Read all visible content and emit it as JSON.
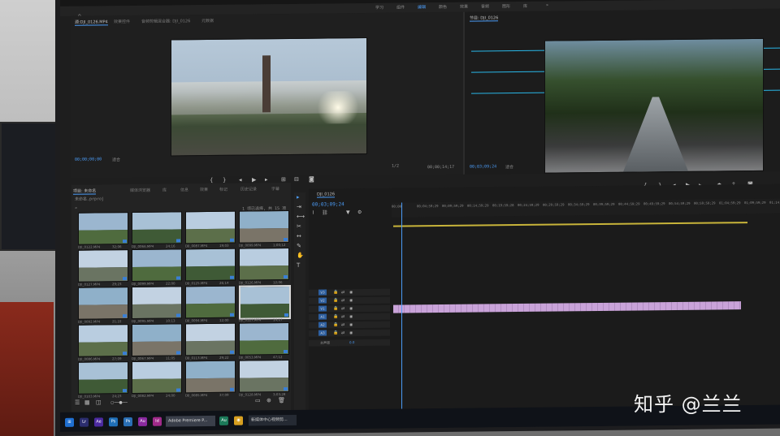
{
  "workspaces": [
    "学习",
    "组件",
    "编辑",
    "颜色",
    "效果",
    "音频",
    "图形",
    "库"
  ],
  "active_workspace": "编辑",
  "source": {
    "tabs": [
      "源:DJI_0126.MP4",
      "效果控件",
      "音频剪辑混合器: DJI_0126",
      "元数据"
    ],
    "timecode": "00;00;00;00",
    "zoom": "适合",
    "page": "1/2",
    "duration": "00;00;14;17"
  },
  "program": {
    "tab": "节目: DJI_0126",
    "timecode": "00;03;09;24",
    "zoom": "适合"
  },
  "project": {
    "tabs": [
      "项目: 未命名",
      "媒体浏览器",
      "库",
      "信息",
      "效果",
      "标记",
      "历史记录",
      "字幕"
    ],
    "file": "未命名.prproj",
    "selection_info": "1 项已选择, 共 15 项",
    "thumbs": [
      {
        "name": "DJI_0122.MP4",
        "dur": "32;06"
      },
      {
        "name": "DJI_0066.MP4",
        "dur": "24;16"
      },
      {
        "name": "DJI_0087.MP4",
        "dur": "19;03"
      },
      {
        "name": "DJI_0099.MP4",
        "dur": "1;00;12"
      },
      {
        "name": "DJI_0127.MP4",
        "dur": "29;23"
      },
      {
        "name": "DJI_0099.MP4",
        "dur": "22;00"
      },
      {
        "name": "DJI_0125.MP4",
        "dur": "26;14"
      },
      {
        "name": "DJI_0126.MP4",
        "dur": "12;06"
      },
      {
        "name": "DJI_0092.MP4",
        "dur": "21;22"
      },
      {
        "name": "DJI_0095.MP4",
        "dur": "10;13"
      },
      {
        "name": "DJI_0094.MP4",
        "dur": "12;00"
      },
      {
        "name": "DJI_0127.MP4",
        "dur": "14;17"
      },
      {
        "name": "DJI_0086.MP4",
        "dur": "27;09"
      },
      {
        "name": "DJI_0067.MP4",
        "dur": "11;05"
      },
      {
        "name": "DJI_0113.MP4",
        "dur": "29;22"
      },
      {
        "name": "DJI_0053.MP4",
        "dur": "47;12"
      },
      {
        "name": "DJI_0103.MP4",
        "dur": "24;23"
      },
      {
        "name": "DJI_0082.MP4",
        "dur": "24;00"
      },
      {
        "name": "DJI_0085.MP4",
        "dur": "37;09"
      },
      {
        "name": "DJI_0128.MP4",
        "dur": "3;03;28"
      }
    ]
  },
  "timeline": {
    "tab": "DJI_0126",
    "timecode": "00;03;09;24",
    "ticks": [
      "00;00",
      "00;04;59;29",
      "00;09;59;29",
      "00;14;59;29",
      "00;19;59;28",
      "00;24;59;29",
      "00;29;59;29",
      "00;34;59;29",
      "00;39;59;29",
      "00;44;59;29",
      "00;49;59;29",
      "00;54;59;29",
      "00;59;59;29",
      "01;04;59;29",
      "01;09;59;29",
      "01;14;59;29"
    ],
    "tracks": [
      "V3",
      "V2",
      "V1",
      "A1",
      "A2",
      "A3"
    ],
    "master_label": "主声道",
    "master_value": "0.0"
  },
  "taskbar": {
    "premiere_label": "Adobe Premiere P...",
    "other_label": "新媒体中心视频剪..."
  },
  "watermark": "知乎 @兰兰",
  "colors": {
    "accent": "#4b9bf5",
    "clip": "#c9a3d9",
    "work_area": "#c8b43a",
    "guide": "#29b7e8"
  }
}
